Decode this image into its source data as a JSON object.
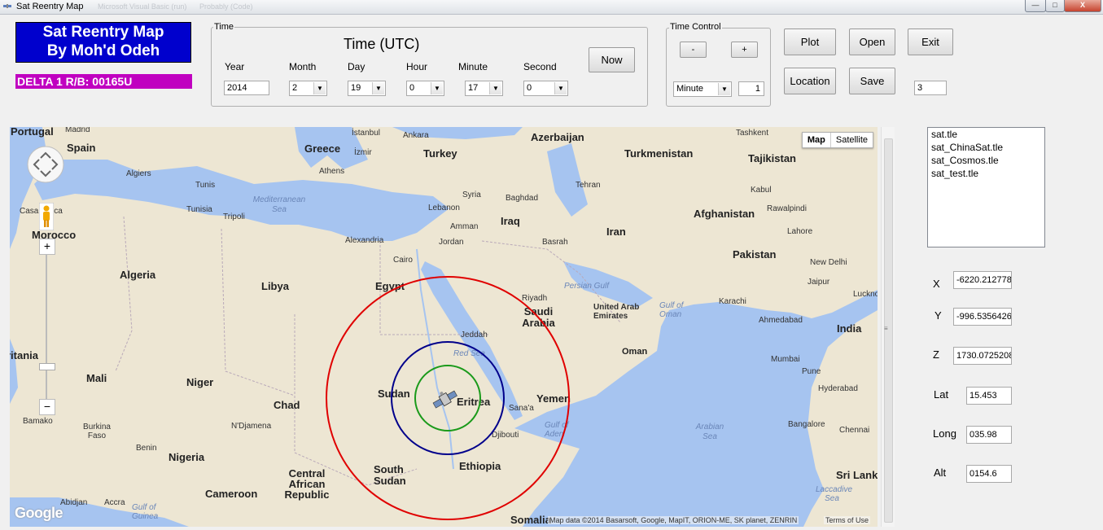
{
  "window": {
    "title": "Sat Reentry Map",
    "ghost_titles": [
      "Microsoft Visual Basic (run)",
      "Probably (Code)"
    ],
    "buttons": {
      "minimize": "—",
      "maximize": "□",
      "close": "X"
    }
  },
  "brand": {
    "line1": "Sat Reentry Map",
    "line2": "By Moh'd Odeh"
  },
  "satellite": {
    "name": "DELTA 1 R/B: 00165U"
  },
  "time": {
    "group_label": "Time",
    "heading": "Time (UTC)",
    "fields": [
      {
        "label": "Year",
        "value": "2014",
        "kind": "text"
      },
      {
        "label": "Month",
        "value": "2",
        "kind": "select"
      },
      {
        "label": "Day",
        "value": "19",
        "kind": "select"
      },
      {
        "label": "Hour",
        "value": "0",
        "kind": "select"
      },
      {
        "label": "Minute",
        "value": "17",
        "kind": "select"
      },
      {
        "label": "Second",
        "value": "0",
        "kind": "select"
      }
    ],
    "now_button": "Now"
  },
  "time_control": {
    "group_label": "Time Control",
    "minus": "-",
    "plus": "+",
    "unit": "Minute",
    "step": "1"
  },
  "actions": {
    "plot": "Plot",
    "open": "Open",
    "exit": "Exit",
    "location": "Location",
    "save": "Save",
    "extra_value": "3"
  },
  "files": [
    "sat.tle",
    "sat_ChinaSat.tle",
    "sat_Cosmos.tle",
    "sat_test.tle"
  ],
  "coords": {
    "x": {
      "label": "X",
      "value": "-6220.212778"
    },
    "y": {
      "label": "Y",
      "value": "-996.5356426"
    },
    "z": {
      "label": "Z",
      "value": "1730.0725208"
    },
    "lat": {
      "label": "Lat",
      "value": "15.453"
    },
    "long": {
      "label": "Long",
      "value": "035.98"
    },
    "alt": {
      "label": "Alt",
      "value": "0154.6"
    }
  },
  "map": {
    "type_map": "Map",
    "type_satellite": "Satellite",
    "attribution": "Map data ©2014 Basarsoft, Google, MapIT, ORION-ME, SK planet, ZENRIN",
    "terms": "Terms of Use",
    "logo": "Google",
    "zoom_in": "+",
    "zoom_out": "−",
    "colors": {
      "outer_ring": "#e00000",
      "middle_ring": "#00008b",
      "inner_ring": "#1a9a1a",
      "water": "#a6c4f0",
      "land": "#ede6d3"
    },
    "labels": {
      "portugal": "Portugal",
      "madrid": "Madrid",
      "spain": "Spain",
      "greece": "Greece",
      "athens": "Athens",
      "algiers": "Algiers",
      "tunis": "Tunis",
      "tunisia": "Tunisia",
      "tripoli": "Tripoli",
      "casablanca": "Casablanca",
      "morocco": "Morocco",
      "algeria": "Algeria",
      "libya": "Libya",
      "egypt": "Egypt",
      "cairo": "Cairo",
      "alexandria": "Alexandria",
      "mauritania": "ritania",
      "mali": "Mali",
      "niger": "Niger",
      "chad": "Chad",
      "sudan": "Sudan",
      "south_sudan": "South Sudan",
      "eritrea": "Eritrea",
      "ethiopia": "Ethiopia",
      "djibouti": "Djibouti",
      "somalia": "Somalia",
      "nigeria": "Nigeria",
      "cameroon": "Cameroon",
      "car": "Central African Republic",
      "bamako": "Bamako",
      "burkina": "Burkina Faso",
      "ndjamena": "N'Djamena",
      "benin": "Benin",
      "abidjan": "Abidjan",
      "accra": "Accra",
      "gulf_guinea": "Gulf of Guinea",
      "turkey": "Turkey",
      "istanbul": "İstanbul",
      "ankara": "Ankara",
      "izmir": "İzmir",
      "syria": "Syria",
      "lebanon": "Lebanon",
      "amman": "Amman",
      "jordan": "Jordan",
      "iraq": "Iraq",
      "baghdad": "Baghdad",
      "basrah": "Basrah",
      "iran": "Iran",
      "tehran": "Tehran",
      "azerbaijan": "Azerbaijan",
      "turkmenistan": "Turkmenistan",
      "tajikistan": "Tajikistan",
      "tashkent": "Tashkent",
      "kabul": "Kabul",
      "afghanistan": "Afghanistan",
      "rawalpindi": "Rawalpindi",
      "lahore": "Lahore",
      "pakistan": "Pakistan",
      "new_delhi": "New Delhi",
      "karachi": "Karachi",
      "ahmedabad": "Ahmedabad",
      "jaipur": "Jaipur",
      "lucknow": "Lucknow",
      "india": "India",
      "mumbai": "Mumbai",
      "pune": "Pune",
      "hyderabad": "Hyderabad",
      "bangalore": "Bangalore",
      "chennai": "Chennai",
      "sri_lanka": "Sri Lank",
      "saudi": "Saudi Arabia",
      "uae": "United Arab Emirates",
      "riyadh": "Riyadh",
      "jeddah": "Jeddah",
      "oman": "Oman",
      "yemen": "Yemen",
      "sanaa": "Sana'a",
      "red_sea": "Red Sea",
      "persian_gulf": "Persian Gulf",
      "gulf_oman": "Gulf of Oman",
      "gulf_aden": "Gulf of Aden",
      "arabian_sea": "Arabian Sea",
      "mediterranean": "Mediterranean Sea",
      "laccadive": "Laccadive Sea"
    }
  }
}
